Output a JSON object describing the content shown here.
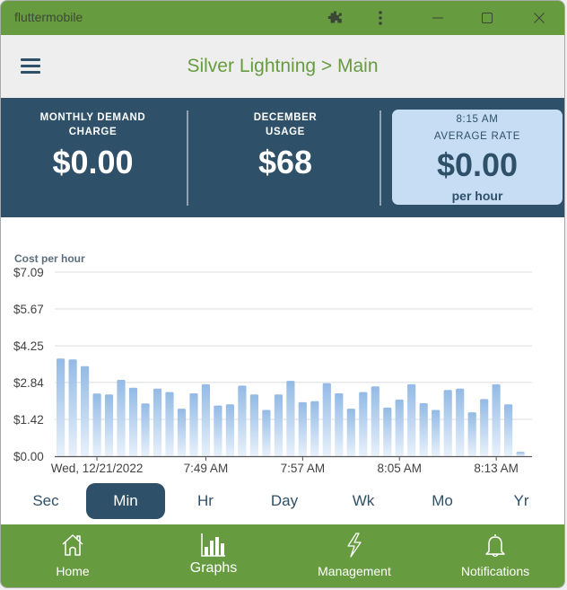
{
  "window": {
    "title": "fluttermobile",
    "controls": [
      "extensions-icon",
      "more-options-icon",
      "minimize-icon",
      "maximize-icon",
      "close-icon"
    ]
  },
  "appbar": {
    "menu_icon": "hamburger-menu-icon",
    "title": "Silver Lightning > Main"
  },
  "summary": {
    "cards": [
      {
        "label_line1": "MONTHLY DEMAND",
        "label_line2": "CHARGE",
        "value": "$0.00"
      },
      {
        "label_line1": "DECEMBER",
        "label_line2": "USAGE",
        "value": "$68"
      },
      {
        "label_line1": "8:15 AM",
        "label_line2": "AVERAGE RATE",
        "value": "$0.00",
        "unit": "per hour"
      }
    ]
  },
  "colors": {
    "brand_green": "#679b3f",
    "navy": "#2f5069",
    "light_blue": "#c6ddf3",
    "bar_blue": "#9bbfe6"
  },
  "chart_data": {
    "type": "bar",
    "title": "",
    "ylabel": "Cost per hour",
    "xlabel": "",
    "ylim": [
      0,
      7.09
    ],
    "y_ticks": [
      "$7.09",
      "$5.67",
      "$4.25",
      "$2.84",
      "$1.42",
      "$0.00"
    ],
    "y_tick_values": [
      7.09,
      5.67,
      4.25,
      2.84,
      1.42,
      0
    ],
    "x_tick_labels": [
      {
        "label": "Wed, 12/21/2022",
        "index": 3
      },
      {
        "label": "7:49 AM",
        "index": 12
      },
      {
        "label": "7:57 AM",
        "index": 20
      },
      {
        "label": "8:05 AM",
        "index": 28
      },
      {
        "label": "8:13 AM",
        "index": 36
      }
    ],
    "grid": true,
    "series": [
      {
        "name": "Cost per hour",
        "values": [
          3.76,
          3.73,
          3.47,
          2.41,
          2.38,
          2.94,
          2.64,
          2.03,
          2.6,
          2.47,
          1.83,
          2.42,
          2.77,
          1.95,
          2.0,
          2.72,
          2.38,
          1.78,
          2.38,
          2.9,
          2.08,
          2.12,
          2.81,
          2.42,
          1.83,
          2.47,
          2.69,
          1.87,
          2.18,
          2.77,
          2.04,
          1.78,
          2.55,
          2.6,
          1.69,
          2.2,
          2.77,
          2.0,
          0.17
        ]
      }
    ]
  },
  "ranges": {
    "items": [
      "Sec",
      "Min",
      "Hr",
      "Day",
      "Wk",
      "Mo",
      "Yr"
    ],
    "selected": "Min"
  },
  "navbar": {
    "items": [
      {
        "label": "Home",
        "icon": "home-icon"
      },
      {
        "label": "Graphs",
        "icon": "bar-chart-icon",
        "active": true
      },
      {
        "label": "Management",
        "icon": "lightning-icon"
      },
      {
        "label": "Notifications",
        "icon": "bell-icon"
      }
    ]
  }
}
